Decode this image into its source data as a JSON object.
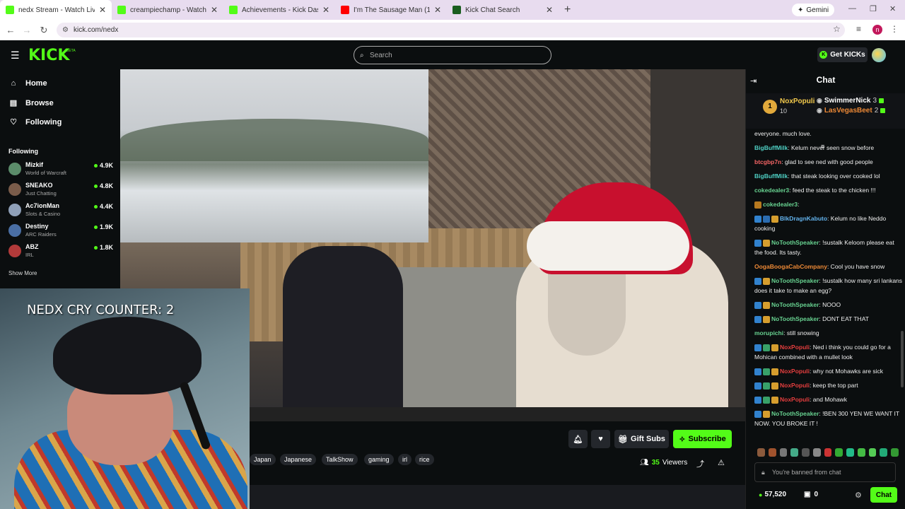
{
  "browser": {
    "tabs": [
      {
        "title": "nedx Stream - Watch Live on K",
        "favicon_color": "#53fc18",
        "active": true
      },
      {
        "title": "creampiechamp - Watch the VO",
        "favicon_color": "#53fc18",
        "active": false
      },
      {
        "title": "Achievements - Kick Dashboard",
        "favicon_color": "#53fc18",
        "active": false
      },
      {
        "title": "I'm The Sausage Man (1990) - Y",
        "favicon_color": "#ff0000",
        "active": false
      },
      {
        "title": "Kick Chat Search",
        "favicon_color": "#1b5e20",
        "active": false
      }
    ],
    "new_tab": "+",
    "gemini_label": "Gemini",
    "url": "kick.com/nedx",
    "profile_initial": "n"
  },
  "kick": {
    "logo": "KICK",
    "beta": "BETA",
    "search_placeholder": "Search",
    "get_kicks": "Get KICKs",
    "accent": "#53fc18"
  },
  "sidebar": {
    "nav": [
      {
        "label": "Home",
        "icon": "home-icon"
      },
      {
        "label": "Browse",
        "icon": "browse-icon"
      },
      {
        "label": "Following",
        "icon": "heart-icon"
      }
    ],
    "following_header": "Following",
    "channels": [
      {
        "name": "Mizkif",
        "category": "World of Warcraft",
        "viewers": "4.9K",
        "avatar_color": "#5b8c6a"
      },
      {
        "name": "SNEAKO",
        "category": "Just Chatting",
        "viewers": "4.8K",
        "avatar_color": "#7a5c4a"
      },
      {
        "name": "Ac7ionMan",
        "category": "Slots & Casino",
        "viewers": "4.4K",
        "avatar_color": "#8fa0b8"
      },
      {
        "name": "Destiny",
        "category": "ARC Raiders",
        "viewers": "1.9K",
        "avatar_color": "#4a6fa5"
      },
      {
        "name": "ABZ",
        "category": "IRL",
        "viewers": "1.8K",
        "avatar_color": "#b23a3a"
      }
    ],
    "show_more": "Show More"
  },
  "overlay": {
    "cry_counter": "NEDX CRY COUNTER: 2"
  },
  "stream": {
    "gift_subs": "Gift Subs",
    "subscribe": "Subscribe",
    "tags": [
      "Japan",
      "Japanese",
      "TalkShow",
      "gaming",
      "irl",
      "rice"
    ],
    "viewers_count": "35",
    "viewers_label": "Viewers"
  },
  "chat": {
    "title": "Chat",
    "leaderboard": {
      "top_rank": "1",
      "top_name": "NoxPopuli",
      "top_count": "10",
      "second_name": "SwimmerNick",
      "second_count": "3",
      "third_name": "LasVegasBeet",
      "third_count": "2"
    },
    "messages": [
      {
        "user": "",
        "color": "#ffffff",
        "text": "everyone. much love.",
        "badges": []
      },
      {
        "user": "BigBuffMilk",
        "color": "#4fd1c5",
        "text": ": Kelum never seen snow before",
        "badges": []
      },
      {
        "user": "btcgbp7n",
        "color": "#f56565",
        "text": ": glad to see ned with good people",
        "badges": []
      },
      {
        "user": "BigBuffMilk",
        "color": "#4fd1c5",
        "text": ": that steak looking over cooked lol",
        "badges": []
      },
      {
        "user": "cokedealer3",
        "color": "#68d391",
        "text": ": feed the steak to the chicken !!!",
        "badges": []
      },
      {
        "user": "cokedealer3",
        "color": "#68d391",
        "text": ":",
        "badges": [
          "#b7791f"
        ]
      },
      {
        "user": "BlkDragnKabuto",
        "color": "#63b3ed",
        "text": ": Kelum no like Neddo cooking",
        "badges": [
          "#3182ce",
          "#2b6cb0",
          "#d69e2e"
        ]
      },
      {
        "user": "NoToothSpeaker",
        "color": "#68d391",
        "text": ": !sustalk Keloom please eat the food. Its tasty.",
        "badges": [
          "#3182ce",
          "#d69e2e"
        ]
      },
      {
        "user": "OogaBoogaCabCompany",
        "color": "#ed8936",
        "text": ": Cool you have snow",
        "badges": []
      },
      {
        "user": "NoToothSpeaker",
        "color": "#68d391",
        "text": ": !sustalk how many sri lankans does it take to make an egg?",
        "badges": [
          "#3182ce",
          "#d69e2e"
        ]
      },
      {
        "user": "NoToothSpeaker",
        "color": "#68d391",
        "text": ": NOOO",
        "badges": [
          "#3182ce",
          "#d69e2e"
        ]
      },
      {
        "user": "NoToothSpeaker",
        "color": "#68d391",
        "text": ": DONT EAT THAT",
        "badges": [
          "#3182ce",
          "#d69e2e"
        ]
      },
      {
        "user": "morupichi",
        "color": "#68d391",
        "text": ": still snowing",
        "badges": []
      },
      {
        "user": "NoxPopuli",
        "color": "#e53e3e",
        "text": ": Ned i think you could go for a Mohican combined with a mullet look",
        "badges": [
          "#3182ce",
          "#38a169",
          "#d69e2e"
        ]
      },
      {
        "user": "NoxPopuli",
        "color": "#e53e3e",
        "text": ": why not Mohawks are sick",
        "badges": [
          "#3182ce",
          "#38a169",
          "#d69e2e"
        ]
      },
      {
        "user": "NoxPopuli",
        "color": "#e53e3e",
        "text": ": keep the top part",
        "badges": [
          "#3182ce",
          "#38a169",
          "#d69e2e"
        ]
      },
      {
        "user": "NoxPopuli",
        "color": "#e53e3e",
        "text": ": and Mohawk",
        "badges": [
          "#3182ce",
          "#38a169",
          "#d69e2e"
        ]
      },
      {
        "user": "NoToothSpeaker",
        "color": "#68d391",
        "text": ": !BEN 300 YEN WE WANT IT NOW. YOU BROKE IT !",
        "badges": [
          "#3182ce",
          "#d69e2e"
        ]
      }
    ],
    "emote_colors": [
      "#8b5a3c",
      "#a0522d",
      "#777",
      "#4a8",
      "#555",
      "#888",
      "#c33",
      "#3a3",
      "#2b8",
      "#4b4",
      "#5c5",
      "#2a7",
      "#393"
    ],
    "banned_text": "You're banned from chat",
    "kicks_balance": "57,520",
    "other_balance": "0",
    "chat_button": "Chat"
  }
}
